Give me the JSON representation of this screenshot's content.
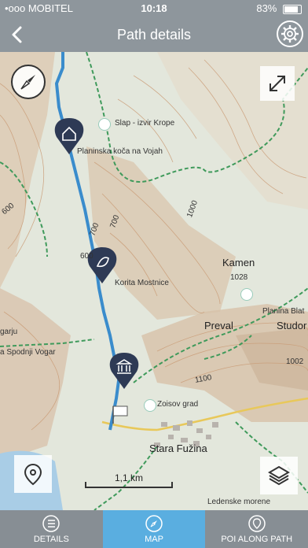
{
  "status_bar": {
    "carrier": "•ooo MOBITEL",
    "time": "10:18",
    "battery": "83%",
    "battery_level": 0.83
  },
  "header": {
    "title": "Path details"
  },
  "map": {
    "labels": {
      "slap": "Slap - izvir Krope",
      "planinska": "Planinska koča na Vojah",
      "korita": "Korita Mostnice",
      "kamen": "Kamen",
      "kamen_alt": "1028",
      "planina_blat": "Planina Blat",
      "preval": "Preval",
      "studor": "Studor",
      "studor_alt": "1002",
      "zoisov": "Zoisov grad",
      "stara_fuzina": "Stara Fužina",
      "ledenske": "Ledenske morene",
      "spodnji_vogar": "a Spodnji Vogar",
      "garju": "garju",
      "c700a": "700",
      "c700b": "700",
      "c1000": "1000",
      "c600": "600",
      "c600b": "600",
      "c1100": "1100"
    },
    "scale_label": "1,1 km"
  },
  "tabs": [
    {
      "label": "DETAILS",
      "icon": "list-icon"
    },
    {
      "label": "MAP",
      "icon": "compass-icon"
    },
    {
      "label": "POI ALONG PATH",
      "icon": "location-pin-icon"
    }
  ],
  "colors": {
    "route": "#3a8ccc",
    "marker": "#2e3a55",
    "active_tab": "#5aaee0",
    "tab_bg": "#878e94"
  }
}
